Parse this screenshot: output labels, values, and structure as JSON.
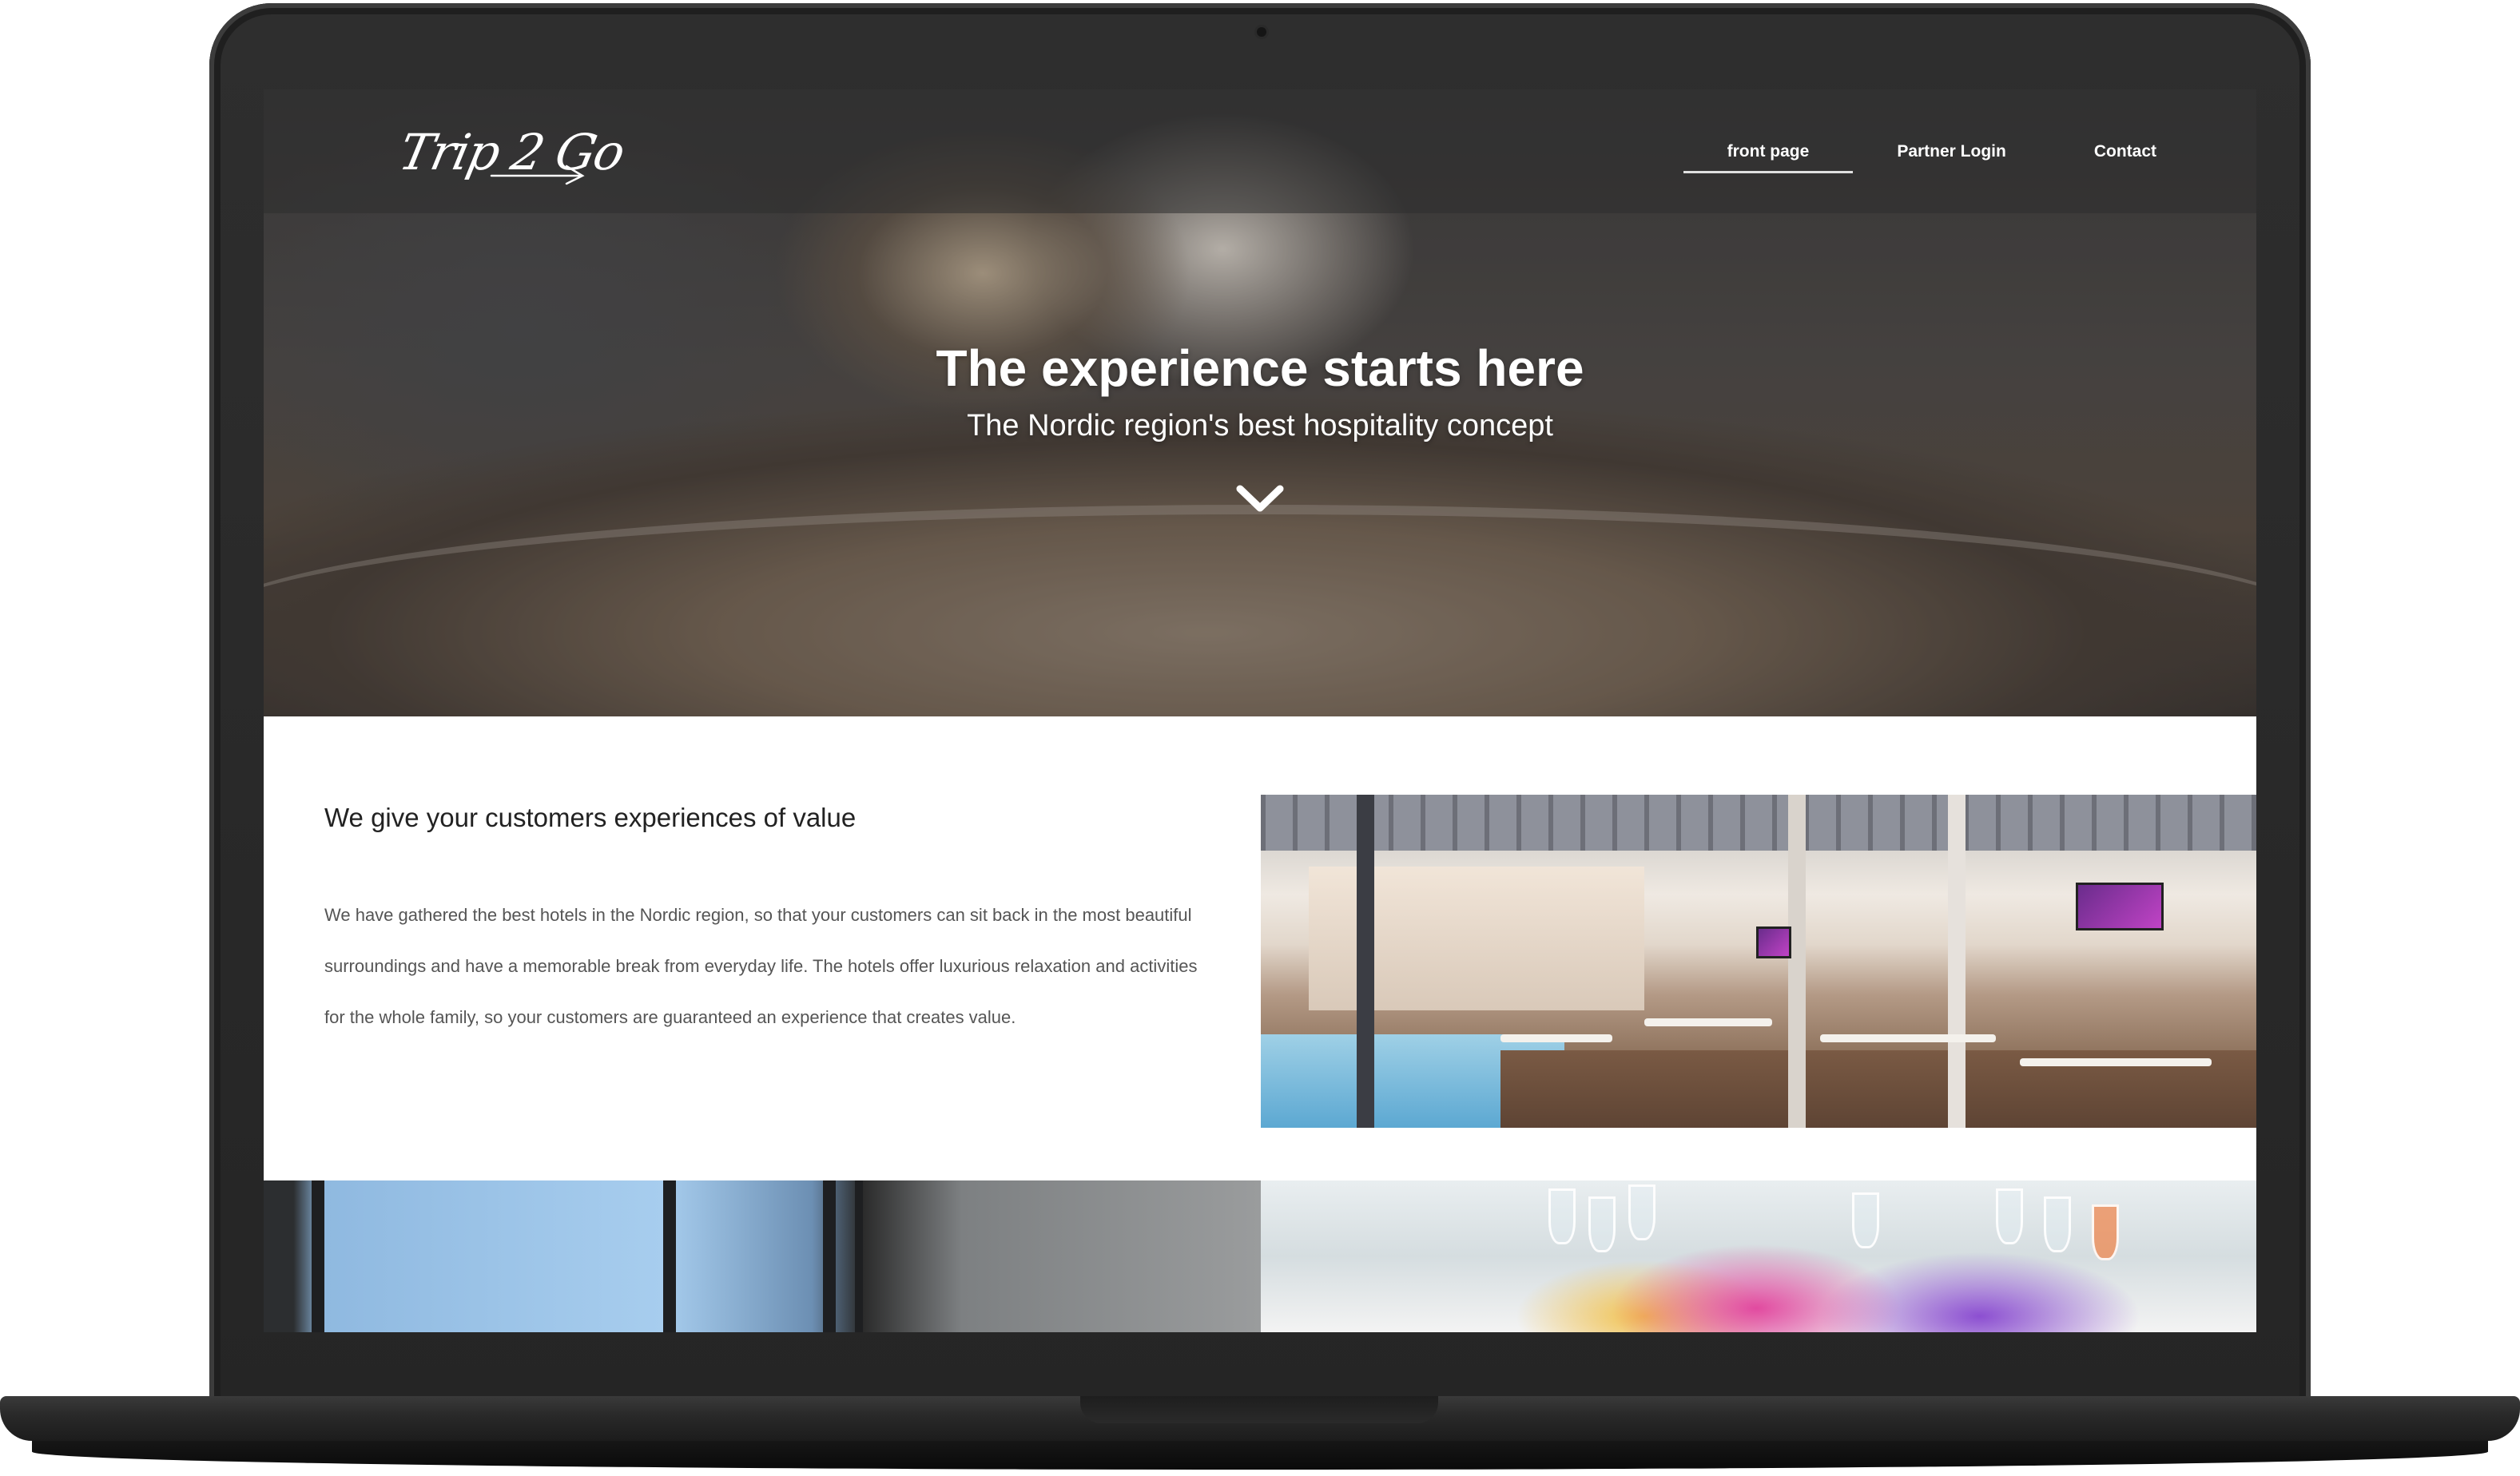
{
  "site": {
    "logo_text": "Trip 2 Go"
  },
  "nav": {
    "items": [
      {
        "label": "front page",
        "active": true
      },
      {
        "label": "Partner Login",
        "active": false
      },
      {
        "label": "Contact",
        "active": false
      }
    ]
  },
  "hero": {
    "title": "The experience starts here",
    "subtitle": "The Nordic region's best hospitality concept",
    "scroll_icon": "chevron-down-icon"
  },
  "intro": {
    "heading": "We give your customers experiences of value",
    "body": "We have gathered the best hotels in the Nordic region, so that your customers can sit back in the most beautiful surroundings and have a memorable break from everyday life. The hotels offer luxurious relaxation and activities for the whole family, so your customers are guaranteed an experience that creates value."
  },
  "colors": {
    "device": "#2e2e2e",
    "nav_overlay": "rgba(45,45,45,0.55)",
    "heading_text": "#222222",
    "body_text": "#555555"
  }
}
